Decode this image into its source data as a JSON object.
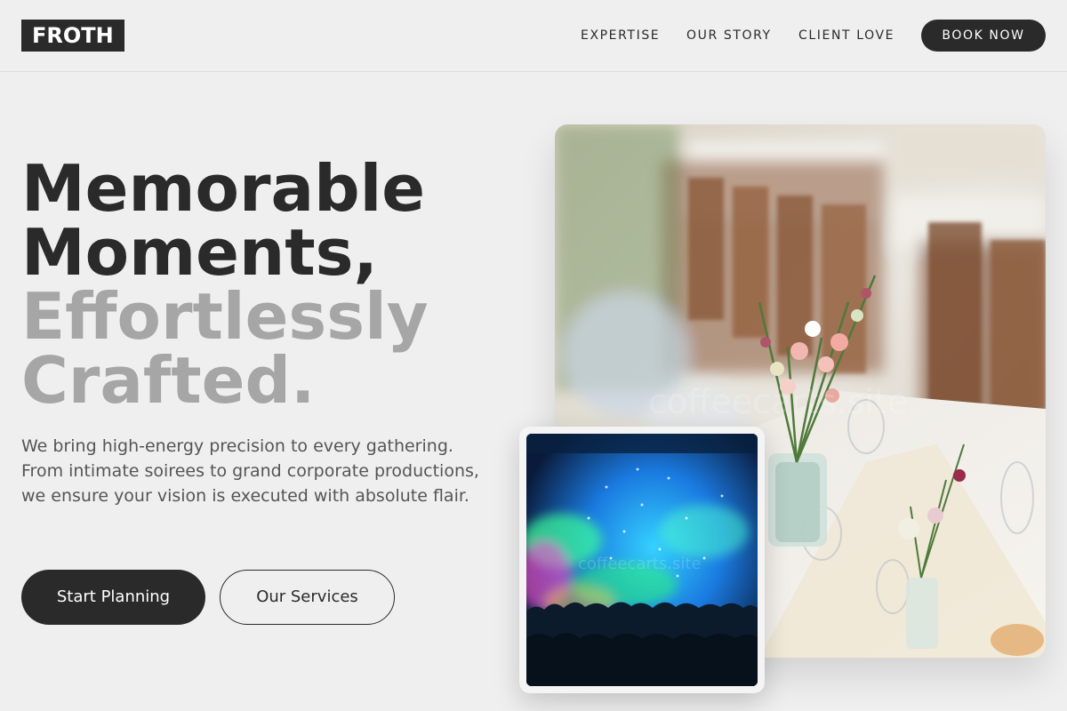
{
  "header": {
    "logo": "FROTH",
    "nav": [
      "EXPERTISE",
      "OUR STORY",
      "CLIENT LOVE"
    ],
    "cta": "BOOK NOW"
  },
  "hero": {
    "headline_dark": [
      "Memorable",
      "Moments,"
    ],
    "headline_light": [
      "Effortlessly",
      "Crafted."
    ],
    "lead": "We bring high-energy precision to every gathering. From intimate soirees to grand corporate productions, we ensure your vision is executed with absolute flair.",
    "primary_button": "Start Planning",
    "secondary_button": "Our Services"
  },
  "images": {
    "main_watermark": "coffeecarts.site",
    "inset_watermark": "coffeecarts.site"
  }
}
